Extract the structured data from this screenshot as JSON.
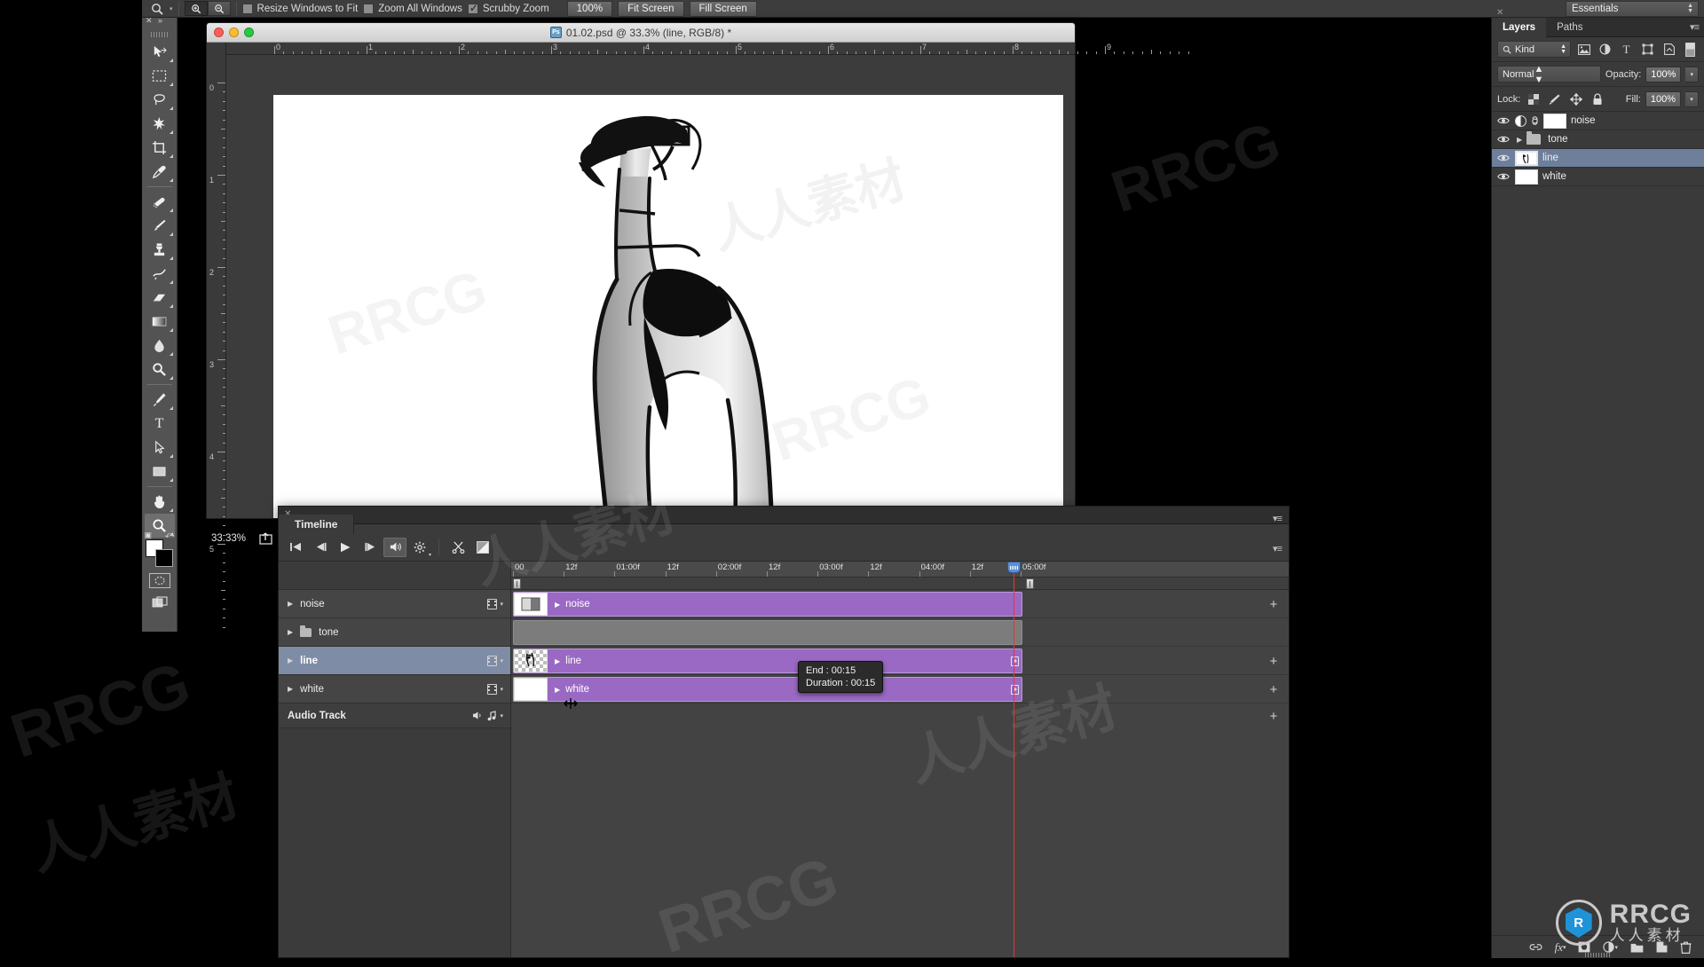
{
  "app": {
    "name": "Adobe Photoshop",
    "workspace": "Essentials"
  },
  "options_bar": {
    "tool_icon": "zoom-icon",
    "zoom_in_label": "+",
    "zoom_out_label": "−",
    "checkboxes": [
      {
        "label": "Resize Windows to Fit",
        "checked": false
      },
      {
        "label": "Zoom All Windows",
        "checked": false
      },
      {
        "label": "Scrubby Zoom",
        "checked": true
      }
    ],
    "buttons": [
      "100%",
      "Fit Screen",
      "Fill Screen"
    ]
  },
  "toolbar": {
    "tools": [
      {
        "name": "move-tool",
        "glyph": "move"
      },
      {
        "name": "marquee-tool",
        "glyph": "marquee"
      },
      {
        "name": "lasso-tool",
        "glyph": "lasso"
      },
      {
        "name": "magic-wand-tool",
        "glyph": "wand"
      },
      {
        "name": "crop-tool",
        "glyph": "crop"
      },
      {
        "name": "eyedropper-tool",
        "glyph": "eyedropper"
      },
      {
        "name": "healing-brush-tool",
        "glyph": "healing"
      },
      {
        "name": "brush-tool",
        "glyph": "brush"
      },
      {
        "name": "clone-stamp-tool",
        "glyph": "stamp"
      },
      {
        "name": "history-brush-tool",
        "glyph": "history"
      },
      {
        "name": "eraser-tool",
        "glyph": "eraser"
      },
      {
        "name": "gradient-tool",
        "glyph": "gradient"
      },
      {
        "name": "blur-tool",
        "glyph": "blur"
      },
      {
        "name": "dodge-tool",
        "glyph": "dodge"
      },
      {
        "name": "pen-tool",
        "glyph": "pen"
      },
      {
        "name": "type-tool",
        "glyph": "T"
      },
      {
        "name": "path-selection-tool",
        "glyph": "arrow"
      },
      {
        "name": "shape-tool",
        "glyph": "shape"
      },
      {
        "name": "hand-tool",
        "glyph": "hand"
      },
      {
        "name": "zoom-tool",
        "glyph": "zoom",
        "active": true
      }
    ],
    "foreground_color": "#ffffff",
    "background_color": "#000000"
  },
  "document": {
    "title": "01.02.psd @ 33.3% (line, RGB/8) *",
    "filename": "01.02.psd",
    "zoom": "33.3%",
    "active_layer": "line",
    "mode": "RGB/8",
    "modified": true,
    "ruler_h_labels": [
      "0",
      "1",
      "2",
      "3",
      "4",
      "5",
      "6",
      "7",
      "8",
      "9"
    ],
    "ruler_v_labels": [
      "0",
      "1",
      "2",
      "3",
      "4",
      "5"
    ],
    "status_zoom": "33.33%"
  },
  "timeline": {
    "panel_title": "Timeline",
    "controls": [
      {
        "name": "go-to-first-frame-button",
        "glyph": "|◀"
      },
      {
        "name": "previous-frame-button",
        "glyph": "◀|"
      },
      {
        "name": "play-button",
        "glyph": "▶"
      },
      {
        "name": "next-frame-button",
        "glyph": "|▶"
      },
      {
        "name": "audio-button",
        "glyph": "speaker",
        "active": true
      },
      {
        "name": "settings-gear-button",
        "glyph": "gear"
      },
      {
        "name": "split-clip-button",
        "glyph": "scissors"
      },
      {
        "name": "transition-button",
        "glyph": "transition"
      }
    ],
    "ruler_labels": [
      "00",
      "12f",
      "01:00f",
      "12f",
      "02:00f",
      "12f",
      "03:00f",
      "12f",
      "04:00f",
      "12f",
      "05:00f"
    ],
    "playhead_time": "05:00f",
    "tracks": [
      {
        "name": "noise",
        "type": "video",
        "selected": false,
        "has_folder": false,
        "clip_label": "noise",
        "thumb": "noise",
        "clip_start_pct": 0,
        "clip_end_pct": 100,
        "show_endcap": false
      },
      {
        "name": "tone",
        "type": "group",
        "selected": false,
        "has_folder": true,
        "clip_label": "",
        "thumb": "none",
        "clip_start_pct": 0,
        "clip_end_pct": 100,
        "show_endcap": false
      },
      {
        "name": "line",
        "type": "video",
        "selected": true,
        "has_folder": false,
        "clip_label": "line",
        "thumb": "checker",
        "clip_start_pct": 0,
        "clip_end_pct": 100,
        "show_endcap": true
      },
      {
        "name": "white",
        "type": "video",
        "selected": false,
        "has_folder": false,
        "clip_label": "white",
        "thumb": "white",
        "clip_start_pct": 0,
        "clip_end_pct": 100,
        "show_endcap": true
      }
    ],
    "audio_track_label": "Audio Track",
    "tooltip": {
      "line1": "End : 00:15",
      "line2": "Duration : 00:15"
    },
    "add_media_label": "+"
  },
  "layers_panel": {
    "tabs": [
      {
        "label": "Layers",
        "active": true
      },
      {
        "label": "Paths",
        "active": false
      }
    ],
    "filter_label": "Kind",
    "filter_icons": [
      "pixel-filter-icon",
      "adjustment-filter-icon",
      "type-filter-icon",
      "shape-filter-icon",
      "smart-object-filter-icon"
    ],
    "blend_mode": "Normal",
    "opacity_label": "Opacity:",
    "opacity_value": "100%",
    "lock_label": "Lock:",
    "lock_icons": [
      "lock-transparent-icon",
      "lock-image-icon",
      "lock-position-icon",
      "lock-all-icon"
    ],
    "fill_label": "Fill:",
    "fill_value": "100%",
    "layers": [
      {
        "name": "noise",
        "visible": true,
        "selected": false,
        "kind": "adjustment",
        "linked": true,
        "thumb": "white"
      },
      {
        "name": "tone",
        "visible": true,
        "selected": false,
        "kind": "group",
        "linked": false,
        "thumb": "folder"
      },
      {
        "name": "line",
        "visible": true,
        "selected": true,
        "kind": "pixel",
        "linked": false,
        "thumb": "checker"
      },
      {
        "name": "white",
        "visible": true,
        "selected": false,
        "kind": "pixel",
        "linked": false,
        "thumb": "white"
      }
    ],
    "bottom_icons": [
      "link-layers-icon",
      "add-layer-style-icon",
      "add-layer-mask-icon",
      "new-adjustment-layer-icon",
      "new-group-icon",
      "new-layer-icon",
      "delete-layer-icon"
    ]
  },
  "watermarks": {
    "latin": "RRCG",
    "chinese": "人人素材",
    "brand_en": "RRCG",
    "brand_cn": "人人素材",
    "brand_accent": "#1f93d8"
  }
}
